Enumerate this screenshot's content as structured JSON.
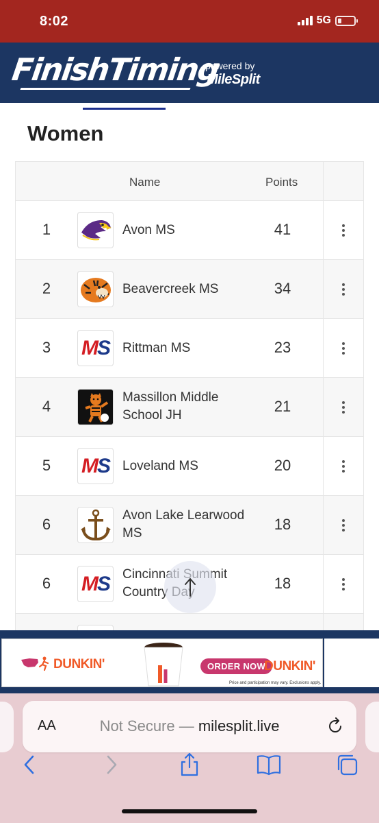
{
  "status_bar": {
    "time": "8:02",
    "network": "5G"
  },
  "header": {
    "logo_text": "FinishTiming",
    "powered_by": "powered by",
    "partner": "MileSplit"
  },
  "section": {
    "title": "Women"
  },
  "table": {
    "columns": {
      "name": "Name",
      "points": "Points"
    },
    "rows": [
      {
        "rank": "1",
        "name": "Avon MS",
        "points": "41",
        "logo": "eagle-logo"
      },
      {
        "rank": "2",
        "name": "Beavercreek MS",
        "points": "34",
        "logo": "tiger-logo"
      },
      {
        "rank": "3",
        "name": "Rittman MS",
        "points": "23",
        "logo": "ms-logo"
      },
      {
        "rank": "4",
        "name": "Massillon Middle School JH",
        "points": "21",
        "logo": "tiger-mascot-logo"
      },
      {
        "rank": "5",
        "name": "Loveland MS",
        "points": "20",
        "logo": "ms-logo"
      },
      {
        "rank": "6",
        "name": "Avon Lake Learwood MS",
        "points": "18",
        "logo": "anchor-logo"
      },
      {
        "rank": "6",
        "name": "Cincinnati Summit Country Day",
        "points": "18",
        "logo": "ms-logo"
      }
    ]
  },
  "ms_logo": {
    "m": "M",
    "s": "S"
  },
  "ad": {
    "brand": "DUNKIN'",
    "cta": "ORDER NOW",
    "fine_print": "Price and participation may vary. Exclusions apply."
  },
  "browser": {
    "text_size": "AA",
    "url_prefix": "Not Secure — ",
    "url_host": "milesplit.live"
  },
  "colors": {
    "status_bar": "#a3261f",
    "header_bg": "#1c3662",
    "tab_indicator": "#1a2d8c",
    "browser_bg": "#e8ccd1",
    "ms_red": "#d41e24",
    "ms_blue": "#1d3a8a",
    "dunkin_orange": "#f05a28",
    "dunkin_pink": "#c8376d"
  }
}
